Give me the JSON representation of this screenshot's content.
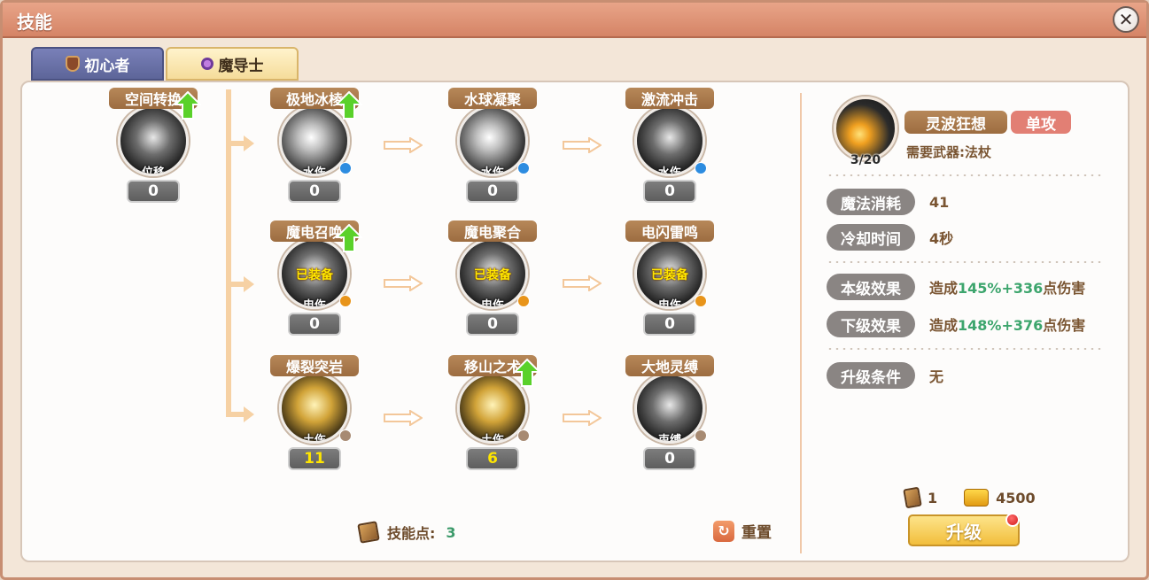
{
  "window": {
    "title": "技能"
  },
  "tabs": [
    {
      "label": "初心者",
      "icon": "shield-icon"
    },
    {
      "label": "魔导士",
      "icon": "staff-gem-icon"
    }
  ],
  "skills": [
    {
      "id": "s0",
      "name": "空间转换",
      "type": "位移",
      "element": "",
      "level": "0",
      "equipped": "",
      "upgradable": true
    },
    {
      "id": "s1",
      "name": "极地冰棱",
      "type": "水伤",
      "element": "water",
      "level": "0",
      "equipped": "",
      "upgradable": true
    },
    {
      "id": "s2",
      "name": "水球凝聚",
      "type": "水伤",
      "element": "water",
      "level": "0",
      "equipped": "",
      "upgradable": false
    },
    {
      "id": "s3",
      "name": "激流冲击",
      "type": "水伤",
      "element": "water",
      "level": "0",
      "equipped": "",
      "upgradable": false
    },
    {
      "id": "s4",
      "name": "魔电召唤",
      "type": "电伤",
      "element": "elec",
      "level": "0",
      "equipped": "已装备",
      "upgradable": true
    },
    {
      "id": "s5",
      "name": "魔电聚合",
      "type": "电伤",
      "element": "elec",
      "level": "0",
      "equipped": "已装备",
      "upgradable": false
    },
    {
      "id": "s6",
      "name": "电闪雷鸣",
      "type": "电伤",
      "element": "elec",
      "level": "0",
      "equipped": "已装备",
      "upgradable": false
    },
    {
      "id": "s7",
      "name": "爆裂突岩",
      "type": "土伤",
      "element": "earth",
      "level": "11",
      "equipped": "",
      "upgradable": false
    },
    {
      "id": "s8",
      "name": "移山之术",
      "type": "土伤",
      "element": "earth",
      "level": "6",
      "equipped": "",
      "upgradable": true
    },
    {
      "id": "s9",
      "name": "大地灵缚",
      "type": "束缚",
      "element": "earth",
      "level": "0",
      "equipped": "",
      "upgradable": false
    }
  ],
  "footer": {
    "skill_points_label": "技能点:",
    "skill_points_value": "3",
    "reset_label": "重置"
  },
  "detail": {
    "name": "灵波狂想",
    "tag": "单攻",
    "level": "3/20",
    "weapon": "需要武器:法杖",
    "stats": [
      {
        "label": "魔法消耗",
        "value": "41"
      },
      {
        "label": "冷却时间",
        "value": "4秒"
      },
      {
        "label": "本级效果",
        "prefix": "造成",
        "highlight": "145%+336",
        "suffix": "点伤害"
      },
      {
        "label": "下级效果",
        "prefix": "造成",
        "highlight": "148%+376",
        "suffix": "点伤害"
      },
      {
        "label": "升级条件",
        "value": "无"
      }
    ],
    "cost_books": "1",
    "cost_gold": "4500",
    "upgrade_label": "升级"
  },
  "colors": {
    "titlebar": "#d58466",
    "tab_active": "#f5dc9a",
    "tab_inactive": "#5d6599",
    "skill_name_bg": "#9c6c40",
    "green_value": "#3da56d",
    "tag_red": "#e27f74"
  }
}
